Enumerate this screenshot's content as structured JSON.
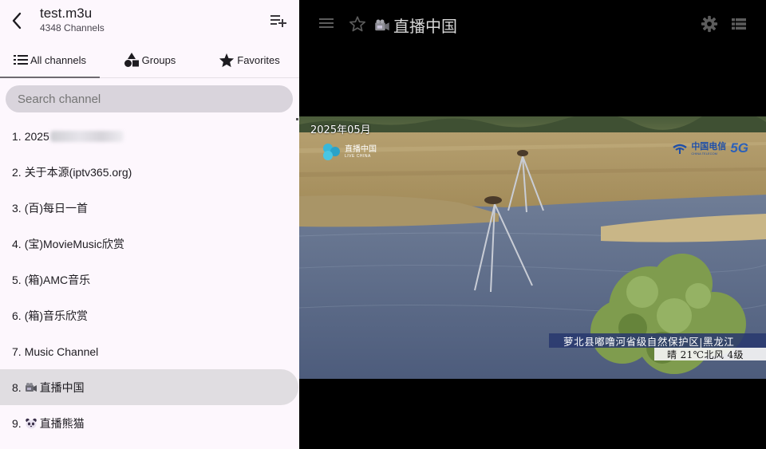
{
  "header": {
    "title": "test.m3u",
    "subtitle": "4348 Channels"
  },
  "tabs": [
    {
      "label": "All channels",
      "icon": "list-icon",
      "active": true
    },
    {
      "label": "Groups",
      "icon": "shapes-icon",
      "active": false
    },
    {
      "label": "Favorites",
      "icon": "star-icon",
      "active": false
    }
  ],
  "search": {
    "placeholder": "Search channel"
  },
  "channels": [
    {
      "num": "1.",
      "name": "2025",
      "blurred": true
    },
    {
      "num": "2.",
      "name": "关于本源(iptv365.org)"
    },
    {
      "num": "3.",
      "name": "(百)每日一首"
    },
    {
      "num": "4.",
      "name": "(宝)MovieMusic欣赏"
    },
    {
      "num": "5.",
      "name": "(箱)AMC音乐"
    },
    {
      "num": "6.",
      "name": "(箱)音乐欣赏"
    },
    {
      "num": "7.",
      "name": "Music Channel"
    },
    {
      "num": "8.",
      "name": "直播中国",
      "icon": "video-camera-icon",
      "selected": true
    },
    {
      "num": "9.",
      "name": "直播熊猫",
      "icon": "panda-icon"
    }
  ],
  "player": {
    "now_playing": "直播中国",
    "now_playing_icon": "video-camera-icon"
  },
  "video_overlay": {
    "date": "2025年05月",
    "logo_text": "直播中国",
    "logo_subtext": "LIVE CHINA",
    "telecom_cn": "中国电信",
    "telecom_en": "CHINA TELECOM",
    "badge_5g": "5G",
    "caption": "萝北县嘟噜河省级自然保护区|黑龙江",
    "weather": "晴 21℃北风 4级"
  },
  "colors": {
    "panel_bg": "#fdf7fd",
    "search_bg": "#d9d4dc",
    "selected_bg": "#e0dde1",
    "player_bg": "#000000"
  }
}
